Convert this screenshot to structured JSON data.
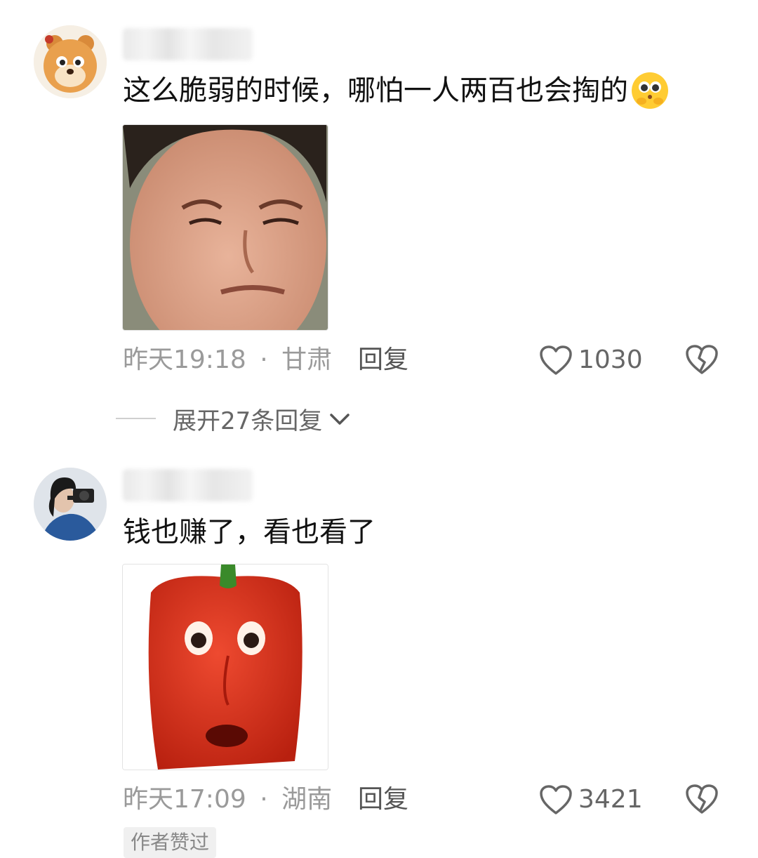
{
  "comments": [
    {
      "text": "这么脆弱的时候，哪怕一人两百也会掏的",
      "timestamp": "昨天19:18",
      "separator": "·",
      "location": "甘肃",
      "reply_label": "回复",
      "likes": "1030",
      "expand_label": "展开27条回复",
      "avatar_icon": "cartoon-bear-avatar",
      "emoji_icon": "pleading-face-emoji",
      "image_icon": "squinting-man-meme",
      "dislike_icon": "broken-heart-icon"
    },
    {
      "text": "钱也赚了，看也看了",
      "timestamp": "昨天17:09",
      "separator": "·",
      "location": "湖南",
      "reply_label": "回复",
      "likes": "3421",
      "author_badge": "作者赞过",
      "avatar_icon": "photographer-avatar",
      "image_icon": "red-pepper-face-meme",
      "dislike_icon": "broken-heart-icon"
    }
  ],
  "colors": {
    "text": "#111111",
    "meta": "#9a9a9a",
    "icon": "#666666",
    "pepper": "#d8321f"
  }
}
